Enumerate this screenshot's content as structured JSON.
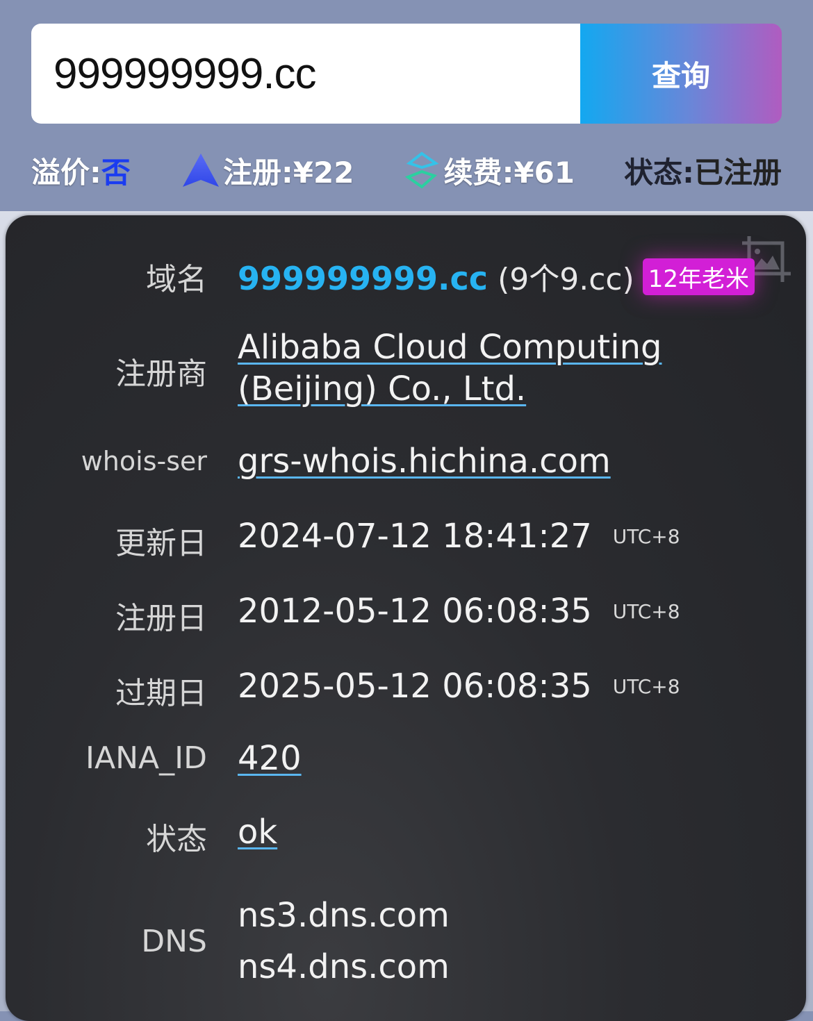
{
  "search": {
    "value": "999999999.cc",
    "button_label": "查询"
  },
  "summary": {
    "premium_label": "溢价:",
    "premium_value": "否",
    "register_label": "注册:¥22",
    "renew_label": "续费:¥61",
    "status_label": "状态:",
    "status_value": "已注册"
  },
  "whois": {
    "domain_label": "域名",
    "domain_value": "999999999.cc",
    "domain_note": "(9个9.cc)",
    "age_badge": "12年老米",
    "registrar_label": "注册商",
    "registrar_line1": "Alibaba Cloud Computing",
    "registrar_line2": "(Beijing) Co., Ltd.",
    "whois_server_label": "whois-ser",
    "whois_server_value": "grs-whois.hichina.com",
    "updated_label": "更新日",
    "updated_value": "2024-07-12 18:41:27",
    "created_label": "注册日",
    "created_value": "2012-05-12 06:08:35",
    "expires_label": "过期日",
    "expires_value": "2025-05-12 06:08:35",
    "timezone": "UTC+8",
    "iana_label": "IANA_ID",
    "iana_value": "420",
    "status_label": "状态",
    "status_value": "ok",
    "dns_label": "DNS",
    "dns_values": [
      "ns3.dns.com",
      "ns4.dns.com"
    ]
  },
  "colors": {
    "accent": "#27b3f2",
    "badge": "#d21fd6",
    "premium": "#1b3cf0",
    "button_gradient": [
      "#13a8f0",
      "#b05cc0"
    ]
  },
  "icons": [
    "triangle-logo-icon",
    "renew-logo-icon",
    "crop-image-icon"
  ]
}
